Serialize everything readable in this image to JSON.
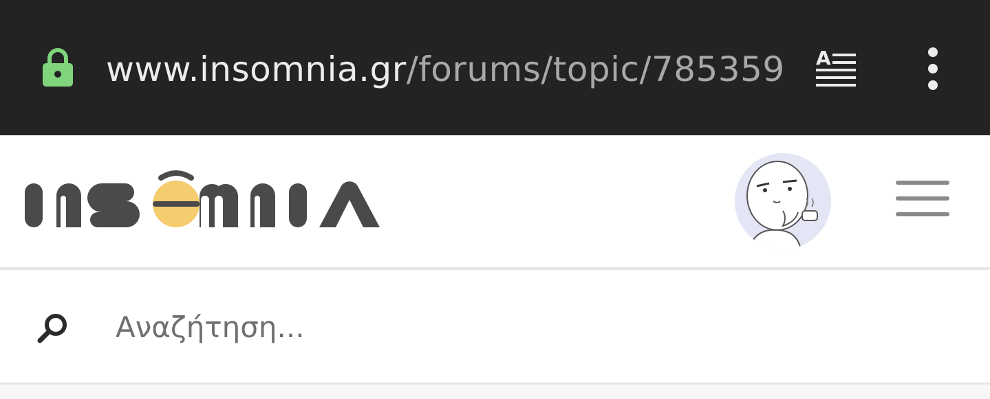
{
  "browser": {
    "url_domain": "www.insomnia.gr",
    "url_path": "/forums/topic/785359",
    "lock_icon": "lock-icon",
    "reader_mode_icon": "reader-mode-icon",
    "menu_icon": "more-vert-icon",
    "lock_color": "#7fd47c",
    "bar_color": "#232323"
  },
  "header": {
    "logo_text": "INSOMNIA",
    "logo_color": "#4a4a4a",
    "logo_accent": "#f5cd6e",
    "avatar_icon": "avatar",
    "menu_icon": "hamburger-menu-icon"
  },
  "search": {
    "placeholder": "Αναζήτηση...",
    "value": "",
    "icon": "search-icon"
  }
}
